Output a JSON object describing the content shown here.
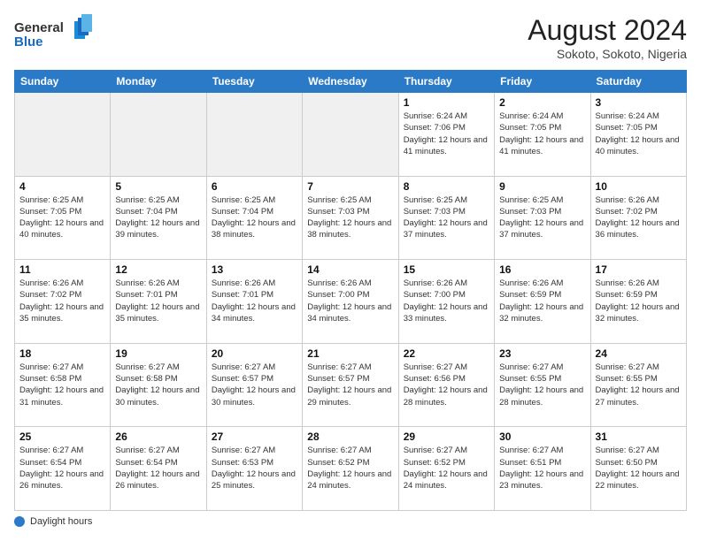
{
  "header": {
    "logo_line1": "General",
    "logo_line2": "Blue",
    "month_year": "August 2024",
    "location": "Sokoto, Sokoto, Nigeria"
  },
  "footer": {
    "label": "Daylight hours"
  },
  "days_of_week": [
    "Sunday",
    "Monday",
    "Tuesday",
    "Wednesday",
    "Thursday",
    "Friday",
    "Saturday"
  ],
  "weeks": [
    [
      {
        "day": "",
        "empty": true
      },
      {
        "day": "",
        "empty": true
      },
      {
        "day": "",
        "empty": true
      },
      {
        "day": "",
        "empty": true
      },
      {
        "day": "1",
        "sunrise": "6:24 AM",
        "sunset": "7:06 PM",
        "daylight": "12 hours and 41 minutes."
      },
      {
        "day": "2",
        "sunrise": "6:24 AM",
        "sunset": "7:05 PM",
        "daylight": "12 hours and 41 minutes."
      },
      {
        "day": "3",
        "sunrise": "6:24 AM",
        "sunset": "7:05 PM",
        "daylight": "12 hours and 40 minutes."
      }
    ],
    [
      {
        "day": "4",
        "sunrise": "6:25 AM",
        "sunset": "7:05 PM",
        "daylight": "12 hours and 40 minutes."
      },
      {
        "day": "5",
        "sunrise": "6:25 AM",
        "sunset": "7:04 PM",
        "daylight": "12 hours and 39 minutes."
      },
      {
        "day": "6",
        "sunrise": "6:25 AM",
        "sunset": "7:04 PM",
        "daylight": "12 hours and 38 minutes."
      },
      {
        "day": "7",
        "sunrise": "6:25 AM",
        "sunset": "7:03 PM",
        "daylight": "12 hours and 38 minutes."
      },
      {
        "day": "8",
        "sunrise": "6:25 AM",
        "sunset": "7:03 PM",
        "daylight": "12 hours and 37 minutes."
      },
      {
        "day": "9",
        "sunrise": "6:25 AM",
        "sunset": "7:03 PM",
        "daylight": "12 hours and 37 minutes."
      },
      {
        "day": "10",
        "sunrise": "6:26 AM",
        "sunset": "7:02 PM",
        "daylight": "12 hours and 36 minutes."
      }
    ],
    [
      {
        "day": "11",
        "sunrise": "6:26 AM",
        "sunset": "7:02 PM",
        "daylight": "12 hours and 35 minutes."
      },
      {
        "day": "12",
        "sunrise": "6:26 AM",
        "sunset": "7:01 PM",
        "daylight": "12 hours and 35 minutes."
      },
      {
        "day": "13",
        "sunrise": "6:26 AM",
        "sunset": "7:01 PM",
        "daylight": "12 hours and 34 minutes."
      },
      {
        "day": "14",
        "sunrise": "6:26 AM",
        "sunset": "7:00 PM",
        "daylight": "12 hours and 34 minutes."
      },
      {
        "day": "15",
        "sunrise": "6:26 AM",
        "sunset": "7:00 PM",
        "daylight": "12 hours and 33 minutes."
      },
      {
        "day": "16",
        "sunrise": "6:26 AM",
        "sunset": "6:59 PM",
        "daylight": "12 hours and 32 minutes."
      },
      {
        "day": "17",
        "sunrise": "6:26 AM",
        "sunset": "6:59 PM",
        "daylight": "12 hours and 32 minutes."
      }
    ],
    [
      {
        "day": "18",
        "sunrise": "6:27 AM",
        "sunset": "6:58 PM",
        "daylight": "12 hours and 31 minutes."
      },
      {
        "day": "19",
        "sunrise": "6:27 AM",
        "sunset": "6:58 PM",
        "daylight": "12 hours and 30 minutes."
      },
      {
        "day": "20",
        "sunrise": "6:27 AM",
        "sunset": "6:57 PM",
        "daylight": "12 hours and 30 minutes."
      },
      {
        "day": "21",
        "sunrise": "6:27 AM",
        "sunset": "6:57 PM",
        "daylight": "12 hours and 29 minutes."
      },
      {
        "day": "22",
        "sunrise": "6:27 AM",
        "sunset": "6:56 PM",
        "daylight": "12 hours and 28 minutes."
      },
      {
        "day": "23",
        "sunrise": "6:27 AM",
        "sunset": "6:55 PM",
        "daylight": "12 hours and 28 minutes."
      },
      {
        "day": "24",
        "sunrise": "6:27 AM",
        "sunset": "6:55 PM",
        "daylight": "12 hours and 27 minutes."
      }
    ],
    [
      {
        "day": "25",
        "sunrise": "6:27 AM",
        "sunset": "6:54 PM",
        "daylight": "12 hours and 26 minutes."
      },
      {
        "day": "26",
        "sunrise": "6:27 AM",
        "sunset": "6:54 PM",
        "daylight": "12 hours and 26 minutes."
      },
      {
        "day": "27",
        "sunrise": "6:27 AM",
        "sunset": "6:53 PM",
        "daylight": "12 hours and 25 minutes."
      },
      {
        "day": "28",
        "sunrise": "6:27 AM",
        "sunset": "6:52 PM",
        "daylight": "12 hours and 24 minutes."
      },
      {
        "day": "29",
        "sunrise": "6:27 AM",
        "sunset": "6:52 PM",
        "daylight": "12 hours and 24 minutes."
      },
      {
        "day": "30",
        "sunrise": "6:27 AM",
        "sunset": "6:51 PM",
        "daylight": "12 hours and 23 minutes."
      },
      {
        "day": "31",
        "sunrise": "6:27 AM",
        "sunset": "6:50 PM",
        "daylight": "12 hours and 22 minutes."
      }
    ]
  ]
}
